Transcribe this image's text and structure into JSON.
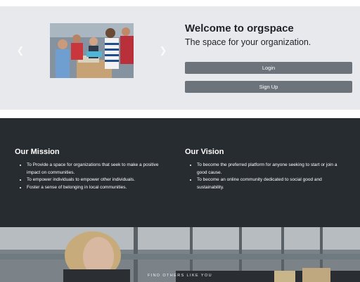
{
  "hero": {
    "title": "Welcome to orgspace",
    "subtitle": "The space for your organization.",
    "login_label": "Login",
    "signup_label": "Sign Up",
    "carousel": {
      "prev_icon": "chevron-left-icon",
      "next_icon": "chevron-right-icon"
    }
  },
  "mission": {
    "heading": "Our Mission",
    "items": [
      "To Provide a space for organizations that seek to make a positive impact on communities.",
      "To empower individuals to empower other individuals.",
      "Foster a sense of belonging in local communities."
    ]
  },
  "vision": {
    "heading": "Our Vision",
    "items": [
      "To become the preferred platform for anyone seeking to start or join a good cause.",
      "To become an online community dedicated to social good and sustainability."
    ]
  },
  "banner": {
    "caption": "FIND OTHERS LIKE YOU"
  },
  "colors": {
    "hero_background": "#e8e9ed",
    "button": "#6c737a",
    "dark_section": "#272c31",
    "text_dark": "#1f2227"
  }
}
